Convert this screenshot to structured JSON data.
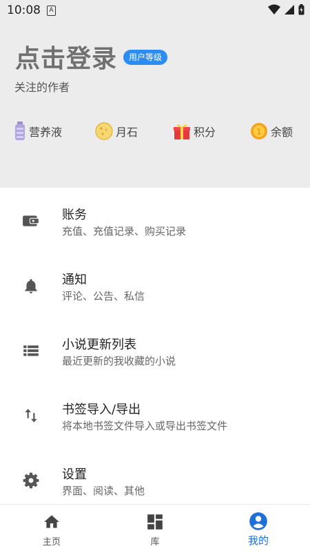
{
  "status_bar": {
    "time": "10:08",
    "notification_icon": "A"
  },
  "header": {
    "login_title": "点击登录",
    "level_badge": "用户等级",
    "follow_label": "关注的作者"
  },
  "assets": [
    {
      "icon": "bottle-icon",
      "label": "营养液"
    },
    {
      "icon": "moonstone-icon",
      "label": "月石"
    },
    {
      "icon": "gift-icon",
      "label": "积分"
    },
    {
      "icon": "coin-icon",
      "label": "余额"
    }
  ],
  "menu": [
    {
      "icon": "wallet-icon",
      "title": "账务",
      "subtitle": "充值、充值记录、购买记录"
    },
    {
      "icon": "bell-icon",
      "title": "通知",
      "subtitle": "评论、公告、私信"
    },
    {
      "icon": "list-icon",
      "title": "小说更新列表",
      "subtitle": "最近更新的我收藏的小说"
    },
    {
      "icon": "import-export-icon",
      "title": "书签导入/导出",
      "subtitle": "将本地书签文件导入或导出书签文件"
    },
    {
      "icon": "settings-icon",
      "title": "设置",
      "subtitle": "界面、阅读、其他"
    }
  ],
  "bottom_nav": [
    {
      "icon": "home-icon",
      "label": "主页",
      "active": false
    },
    {
      "icon": "library-icon",
      "label": "库",
      "active": false
    },
    {
      "icon": "account-icon",
      "label": "我的",
      "active": true
    }
  ],
  "colors": {
    "accent": "#1e6fd9",
    "badge": "#2d8cf0",
    "header_bg": "#ececec"
  }
}
